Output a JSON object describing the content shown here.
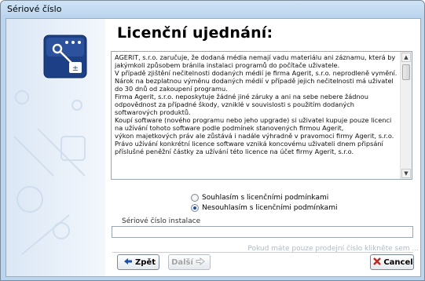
{
  "window": {
    "title": "Sériové číslo"
  },
  "page": {
    "heading": "Licenční ujednání:"
  },
  "license": {
    "paragraphs": [
      "AGERIT, s.r.o. zaručuje, že dodaná média nemají vadu materiálu ani záznamu, která by jakýmkoli způsobem bránila instalaci programů do počítače uživatele.",
      "V případě zjištění nečitelnosti dodaných médií je firma Agerit, s.r.o. neprodleně vymění. Nárok na bezplatnou výměnu dodaných médií v případě jejich nečitelnosti má uživatel do 30 dnů od zakoupení programu.",
      "Firma Agerit, s.r.o. neposkytuje žádné jiné záruky a ani na sebe nebere žádnou odpovědnost za případné škody, vzniklé v souvislosti s použitím dodaných softwarových produktů.",
      "Koupí software (nového programu nebo jeho upgrade) si uživatel kupuje pouze licenci na užívání tohoto software podle podmínek stanovených firmou Agerit,",
      "výkon majetkových práv ale zůstává i nadále výhradně v pravomoci firmy Agerit, s.r.o. Právo užívání konkrétní licence software vzniká koncovému uživateli dnem připsání příslušné peněžní částky za užívání této licence na účet firmy Agerit, s.r.o."
    ]
  },
  "agreement": {
    "accept_label": "Souhlasím s licenčními podmínkami",
    "decline_label": "Nesouhlasím s licenčními podmínkami",
    "selected": "decline"
  },
  "serial": {
    "group_label": "Sériové číslo instalace",
    "value": "",
    "hint": "Pokud máte pouze prodejní číslo klikněte sem ..."
  },
  "buttons": {
    "back": "Zpět",
    "next": "Další",
    "cancel": "Cancel"
  },
  "colors": {
    "accent": "#1f4ea8",
    "title_bg": "#cfe3f6",
    "hint": "#b0bac4"
  }
}
